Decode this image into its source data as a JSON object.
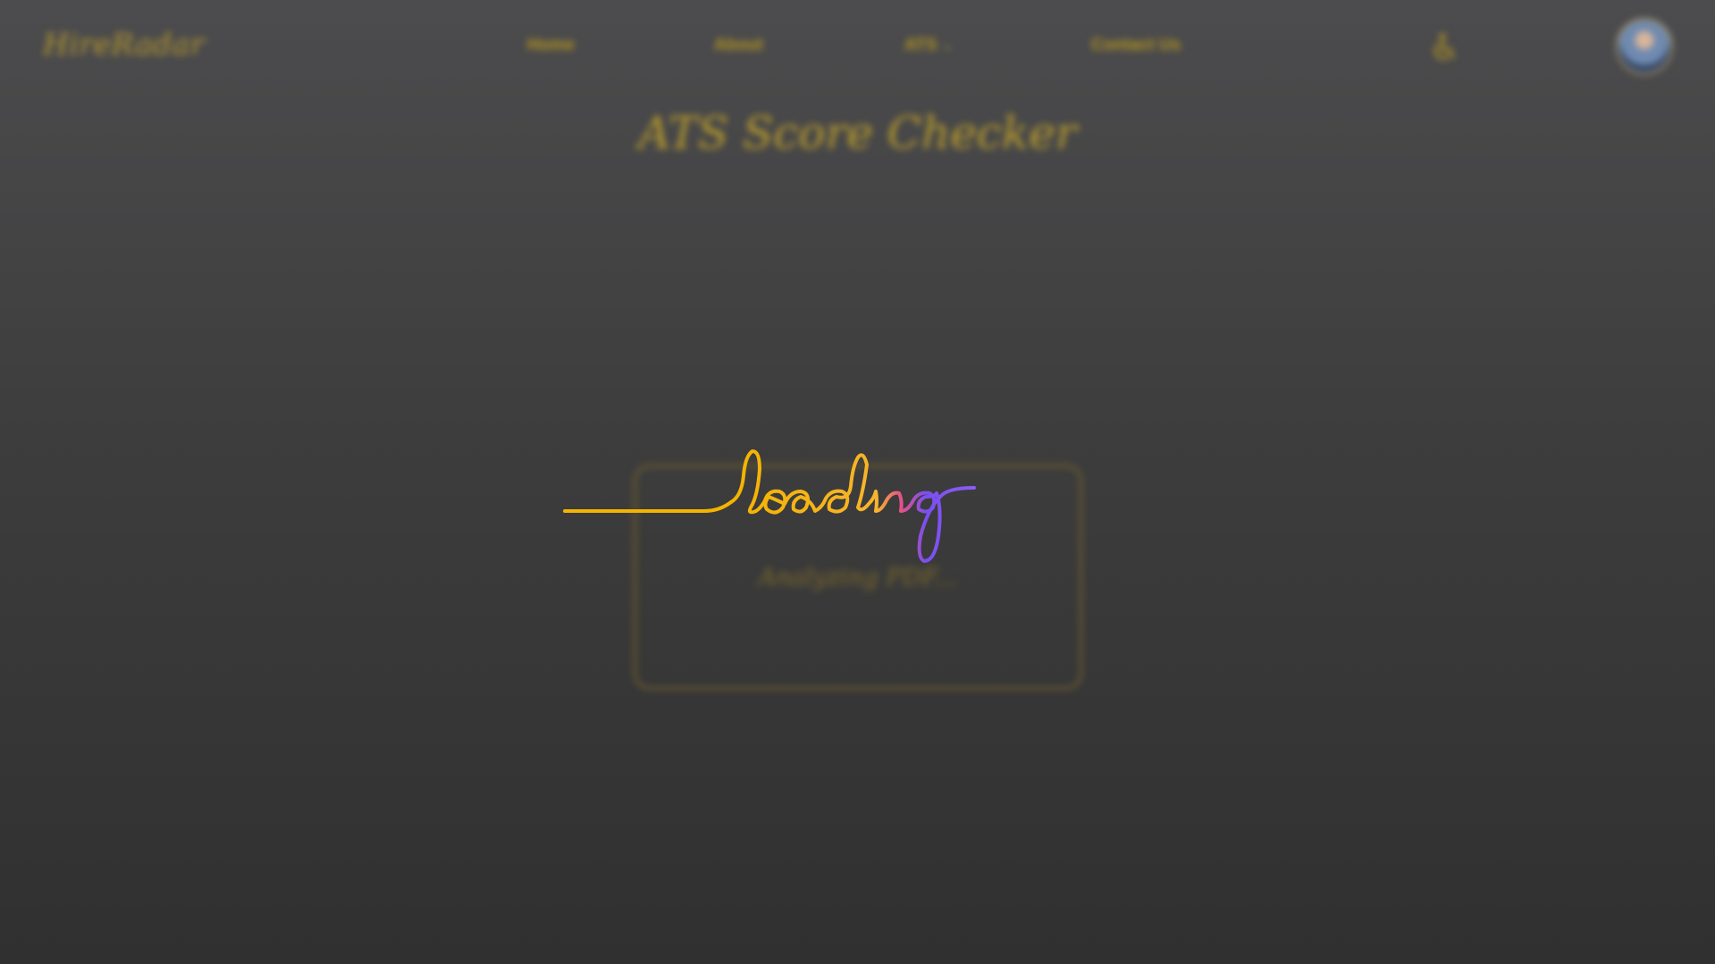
{
  "nav": {
    "logo": "HireRadar",
    "links": [
      {
        "label": "Home"
      },
      {
        "label": "About"
      },
      {
        "label": "ATS",
        "has_dropdown": true
      },
      {
        "label": "Contact Us"
      }
    ]
  },
  "page": {
    "title": "ATS Score Checker"
  },
  "card": {
    "status": "Analyzing PDF..."
  },
  "loader": {
    "text": "loading",
    "colors": [
      "#f4b400",
      "#f7b42c",
      "#e4508a",
      "#7a4ff0",
      "#8a5cf6"
    ]
  },
  "icons": {
    "accessibility": "accessibility-icon",
    "dropdown": "chevron-down-icon",
    "avatar": "user-avatar"
  },
  "theme": {
    "accent": "#b89a2e",
    "background_top": "#4c4c4e",
    "background_bottom": "#303030"
  }
}
